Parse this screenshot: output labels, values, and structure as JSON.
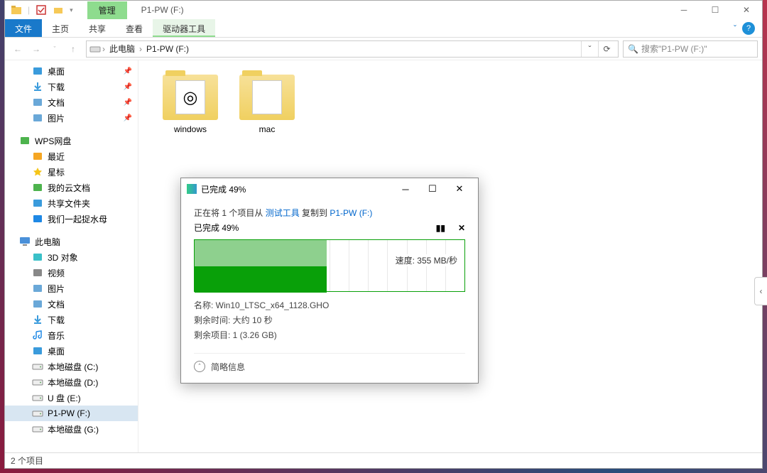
{
  "titlebar": {
    "context_tab": "管理",
    "window_title": "P1-PW  (F:)"
  },
  "ribbon": {
    "file": "文件",
    "home": "主页",
    "share": "共享",
    "view": "查看",
    "drive_tools": "驱动器工具"
  },
  "breadcrumb": {
    "this_pc": "此电脑",
    "current": "P1-PW  (F:)"
  },
  "search": {
    "placeholder": "搜索\"P1-PW  (F:)\""
  },
  "sidebar": {
    "quick": [
      {
        "icon": "desktop",
        "label": "桌面",
        "pin": true
      },
      {
        "icon": "download",
        "label": "下载",
        "pin": true
      },
      {
        "icon": "document",
        "label": "文档",
        "pin": true
      },
      {
        "icon": "picture",
        "label": "图片",
        "pin": true
      }
    ],
    "wps_label": "WPS网盘",
    "wps": [
      {
        "icon": "recent",
        "label": "最近"
      },
      {
        "icon": "star",
        "label": "星标"
      },
      {
        "icon": "cloud",
        "label": "我的云文档"
      },
      {
        "icon": "share",
        "label": "共享文件夹"
      },
      {
        "icon": "box",
        "label": "我们一起捉水母"
      }
    ],
    "this_pc_label": "此电脑",
    "pc": [
      {
        "icon": "3d",
        "label": "3D 对象"
      },
      {
        "icon": "video",
        "label": "视频"
      },
      {
        "icon": "picture",
        "label": "图片"
      },
      {
        "icon": "document",
        "label": "文档"
      },
      {
        "icon": "download",
        "label": "下载"
      },
      {
        "icon": "music",
        "label": "音乐"
      },
      {
        "icon": "desktop",
        "label": "桌面"
      },
      {
        "icon": "drive",
        "label": "本地磁盘 (C:)"
      },
      {
        "icon": "drive",
        "label": "本地磁盘 (D:)"
      },
      {
        "icon": "drive",
        "label": "U 盘 (E:)"
      },
      {
        "icon": "drive",
        "label": "P1-PW  (F:)",
        "sel": true
      },
      {
        "icon": "drive",
        "label": "本地磁盘 (G:)"
      }
    ]
  },
  "folders": [
    {
      "name": "windows",
      "glyph": "◎"
    },
    {
      "name": "mac",
      "glyph": ""
    }
  ],
  "status": {
    "text": "2 个项目"
  },
  "dialog": {
    "title": "已完成 49%",
    "copy_prefix": "正在将 1 个项目从 ",
    "copy_src": "测试工具",
    "copy_mid": " 复制到 ",
    "copy_dst": "P1-PW  (F:)",
    "progress_title": "已完成 49%",
    "progress_pct": 49,
    "speed": "速度: 355 MB/秒",
    "name_label": "名称: ",
    "name_value": "Win10_LTSC_x64_1128.GHO",
    "time_label": "剩余时间: ",
    "time_value": "大约 10 秒",
    "remain_label": "剩余项目: ",
    "remain_value": "1 (3.26 GB)",
    "more": "简略信息"
  }
}
